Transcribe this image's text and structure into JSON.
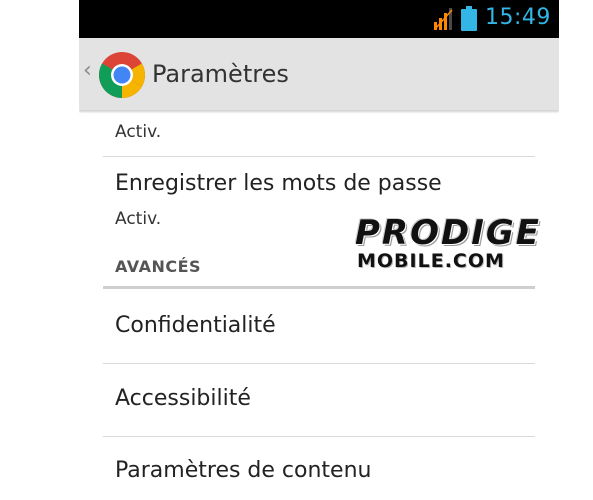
{
  "status_bar": {
    "time": "15:49",
    "icons": [
      "signal-icon",
      "battery-icon"
    ],
    "time_color": "#33b5e5"
  },
  "action_bar": {
    "title": "Paramètres",
    "up_icon": "‹",
    "app_icon": "chrome-icon"
  },
  "settings": {
    "first_item_summary": "Activ.",
    "save_passwords": {
      "title": "Enregistrer les mots de passe",
      "summary": "Activ."
    },
    "advanced_header": "AVANCÉS",
    "items": [
      "Confidentialité",
      "Accessibilité",
      "Paramètres de contenu"
    ]
  },
  "watermark": {
    "line1": "PRODIGE",
    "line2": "MOBILE.COM"
  }
}
